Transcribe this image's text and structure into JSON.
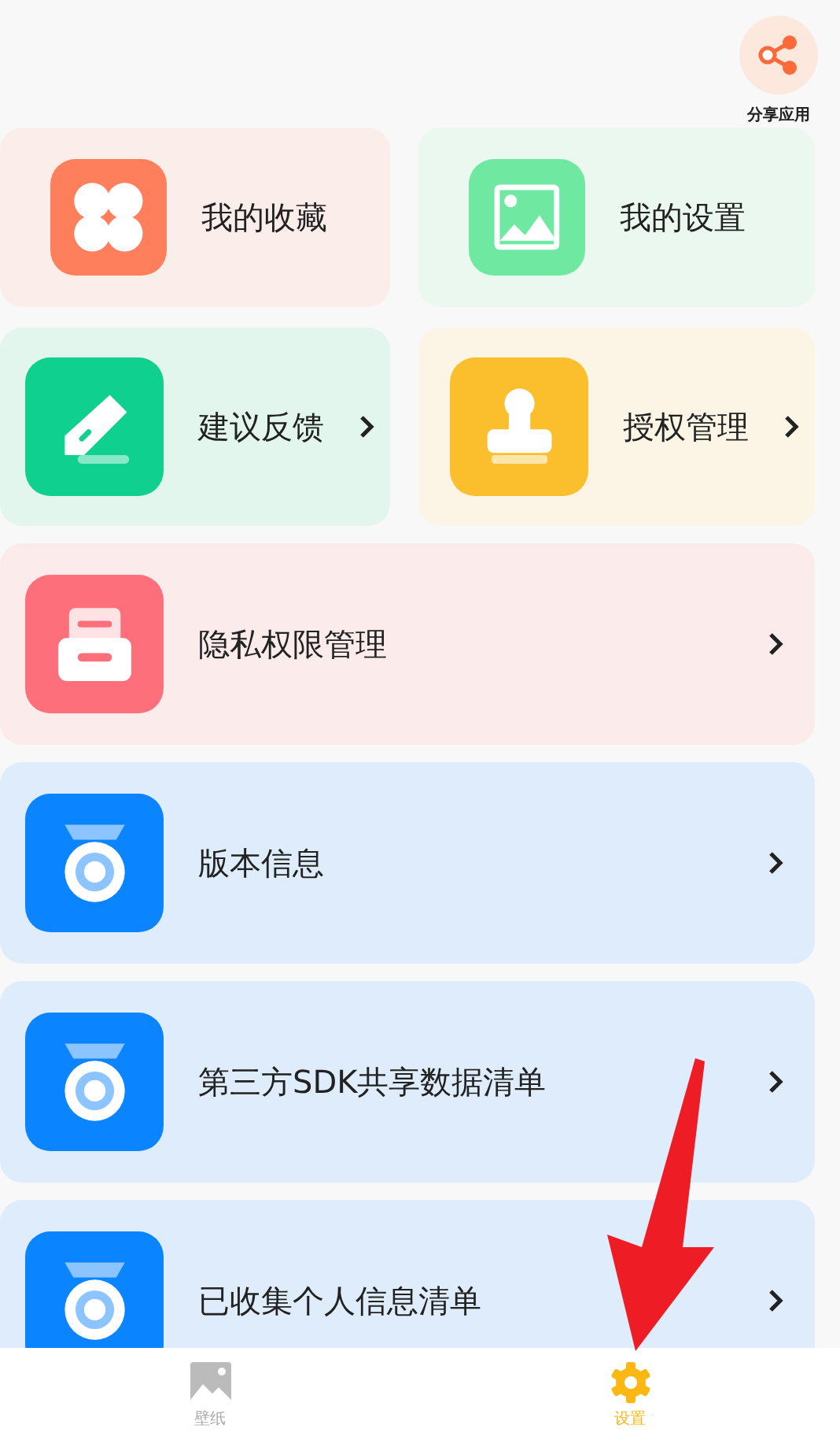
{
  "share": {
    "label": "分享应用"
  },
  "grid": [
    {
      "kind": "clover",
      "label": "我的收藏",
      "chevron": false
    },
    {
      "kind": "image",
      "label": "我的设置",
      "chevron": false
    },
    {
      "kind": "pen",
      "label": "建议反馈",
      "chevron": true
    },
    {
      "kind": "stamp",
      "label": "授权管理",
      "chevron": true
    }
  ],
  "list": [
    {
      "kind": "inbox",
      "label": "隐私权限管理"
    },
    {
      "kind": "badge",
      "label": "版本信息"
    },
    {
      "kind": "badge",
      "label": "第三方SDK共享数据清单"
    },
    {
      "kind": "badge",
      "label": "已收集个人信息清单"
    }
  ],
  "tabs": [
    {
      "kind": "wallpaper",
      "label": "壁纸",
      "selected": false
    },
    {
      "kind": "settings",
      "label": "设置",
      "selected": true
    }
  ]
}
